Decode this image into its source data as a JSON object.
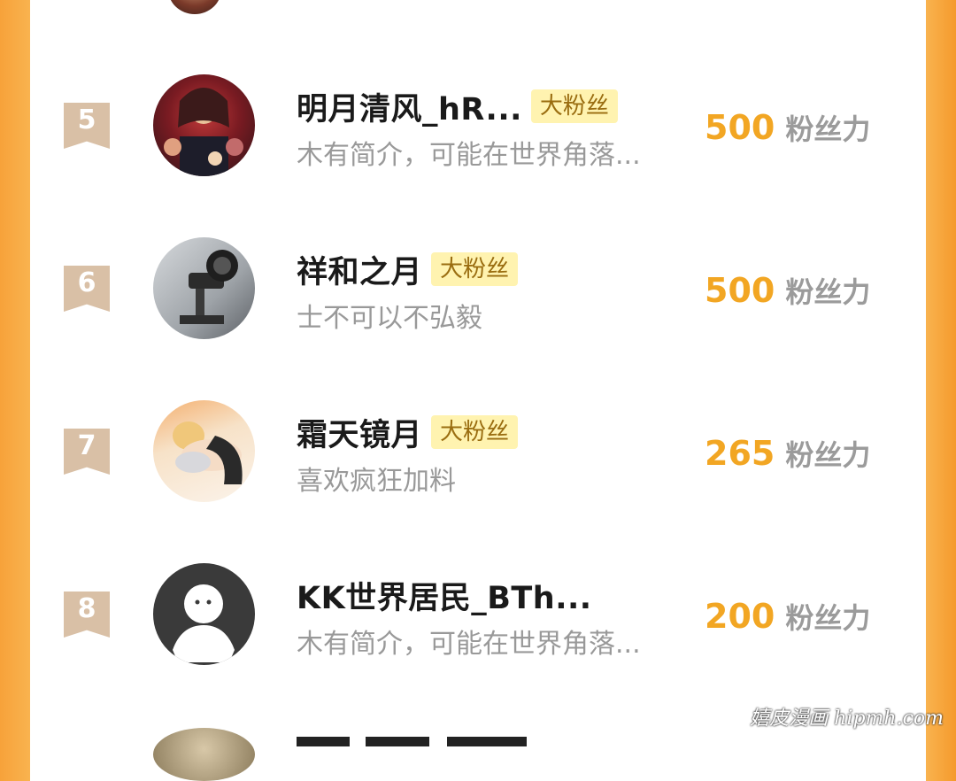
{
  "rows": [
    {
      "rank": "5",
      "name": "明月清风_hR...",
      "badge": "大粉丝",
      "bio": "木有简介，可能在世界角落...",
      "score": "500",
      "unit": "粉丝力"
    },
    {
      "rank": "6",
      "name": "祥和之月",
      "badge": "大粉丝",
      "bio": "士不可以不弘毅",
      "score": "500",
      "unit": "粉丝力"
    },
    {
      "rank": "7",
      "name": "霜天镜月",
      "badge": "大粉丝",
      "bio": "喜欢疯狂加料",
      "score": "265",
      "unit": "粉丝力"
    },
    {
      "rank": "8",
      "name": "KK世界居民_BTh...",
      "badge": "",
      "bio": "木有简介，可能在世界角落...",
      "score": "200",
      "unit": "粉丝力"
    }
  ],
  "watermark": "嬉皮漫画 hipmh.com",
  "colors": {
    "accent_orange": "#f2a623",
    "badge_bg": "#fff3b0",
    "rank_flag": "#d9c0a6",
    "side_bars": "#f7a23a"
  }
}
